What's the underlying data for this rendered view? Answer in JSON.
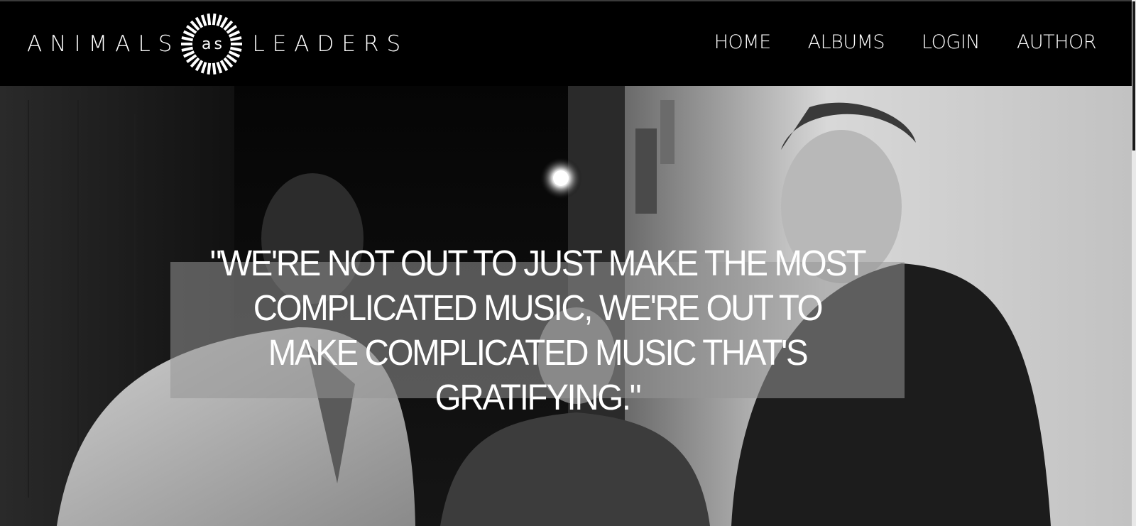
{
  "header": {
    "logo": {
      "word_left": "ANIMALS",
      "word_middle": "as",
      "word_right": "LEADERS",
      "emblem_icon": "sunburst-ring-icon"
    },
    "nav": [
      {
        "label": "HOME"
      },
      {
        "label": "ALBUMS"
      },
      {
        "label": "LOGIN"
      },
      {
        "label": "AUTHOR"
      }
    ]
  },
  "hero": {
    "photo": "band-members-black-and-white-photo",
    "quote": "\"WE'RE NOT OUT TO JUST MAKE THE MOST COMPLICATED MUSIC, WE'RE OUT TO MAKE COMPLICATED MUSIC THAT'S GRATIFYING.\""
  },
  "colors": {
    "background": "#000000",
    "text": "#ffffff",
    "quote_overlay": "#969696"
  }
}
